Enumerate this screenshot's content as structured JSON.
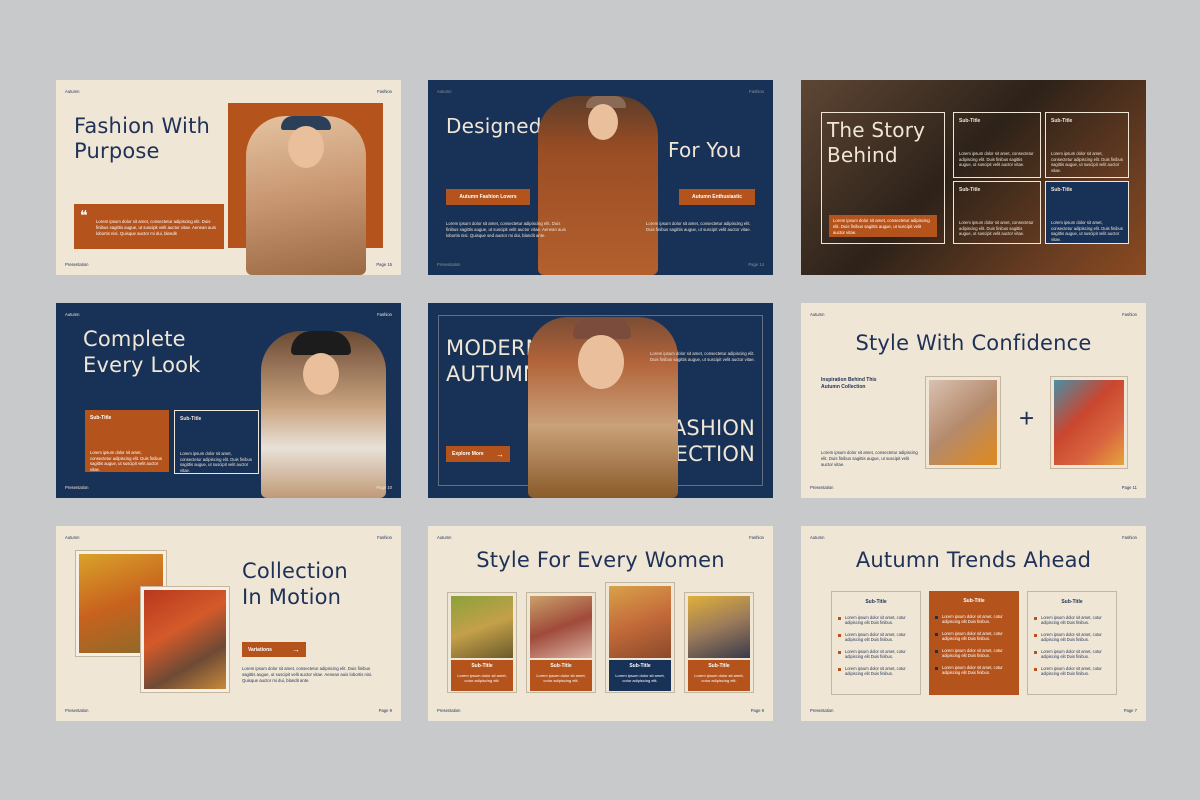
{
  "colors": {
    "background": "#c8c9ca",
    "cream": "#efe6d6",
    "navy": "#183157",
    "rust": "#b5531c"
  },
  "slide1": {
    "brand": "Autumn",
    "tag": "Fashion",
    "title_line1": "Fashion With",
    "title_line2": "Purpose",
    "quote": "Lorem ipsum dolor sit amet, consectetur adipiscing elit. Duis finibus sagittis augue, ut suscipit velit auctor vitae. Aenean auis lobortis nisi. Quisque auctor mi dui, blandit",
    "footer_left": "Presentation",
    "footer_right": "Page 15"
  },
  "slide2": {
    "brand": "Autumn",
    "tag": "Fashion",
    "title_line1": "Designed",
    "title_line2": "For You",
    "badge_left": "Autumn Fashion Lovers",
    "badge_right": "Autumn Enthusiastic",
    "text_left": "Lorem ipsum dolor sit amet, consectetur adipiscing elit. Duis finibus sagittis augue, ut suscipit velit auctor vitae. Aenean auis lobortis nisi. Quisque sed auctor mi dui, blandit ante.",
    "text_right": "Lorem ipsum dolor sit amet, consectetur adipiscing elit. Duis finibus sagittis augue, ut suscipit velit auctor vitae.",
    "footer_left": "Presentation",
    "footer_right": "Page 14"
  },
  "slide3": {
    "title_line1": "The Story",
    "title_line2": "Behind",
    "body": "Lorem ipsum dolor sit amet, consectetur adipiscing elit. Duis finibus sagittis augue, ut suscipit velit auctor vitae.",
    "box_label": "Sub-Title",
    "box_text": "Lorem ipsum dolor sit amet, consectetur adipiscing elit. Duis finibus sagittis augue, ut suscipit velit auctor vitae."
  },
  "slide4": {
    "brand": "Autumn",
    "tag": "Fashion",
    "title_line1": "Complete",
    "title_line2": "Every Look",
    "box1_label": "Sub-Title",
    "box2_label": "Sub-Title",
    "box_text": "Lorem ipsum dolor sit amet, consectetur adipiscing elit. Duis finibus sagittis augue, ut suscipit velit auctor vitae.",
    "footer_left": "Presentation",
    "footer_right": "Page 10"
  },
  "slide5": {
    "title_line1": "MODERN",
    "title_line2": "AUTUMN",
    "title_line3": "FASHION",
    "title_line4": "COLLECTION",
    "text": "Lorem ipsum dolor sit amet, consectetur adipiscing elit. Duis finibus sagittis augue, ut suscipit velit auctor vitae.",
    "button": "Explore More"
  },
  "slide6": {
    "brand": "Autumn",
    "tag": "Fashion",
    "title": "Style With Confidence",
    "subtitle_line1": "Inspiration Behind This",
    "subtitle_line2": "Autumn Collection",
    "text": "Lorem ipsum dolor sit amet, consectetur adipiscing elit. Duis finibus sagittis augue, ut suscipit velit auctor vitae.",
    "plus": "+",
    "footer_left": "Presentation",
    "footer_right": "Page 11"
  },
  "slide7": {
    "brand": "Autumn",
    "tag": "Fashion",
    "title_line1": "Collection",
    "title_line2": "In Motion",
    "button": "Variations",
    "text": "Lorem ipsum dolor sit amet, consectetur adipiscing elit. Duis finibus sagittis augue, ut suscipit velit auctor vitae. Aenean auis lobortis nisi. Quisque auctor mi dui, blandit ante.",
    "footer_left": "Presentation",
    "footer_right": "Page 9"
  },
  "slide8": {
    "brand": "Autumn",
    "tag": "Fashion",
    "title": "Style For Every Women",
    "card_label": "Sub-Title",
    "card_text": "Lorem ipsum dolor sit amet, cotur adipiscing elit.",
    "footer_left": "Presentation",
    "footer_right": "Page 8"
  },
  "slide9": {
    "brand": "Autumn",
    "tag": "Fashion",
    "title": "Autumn Trends Ahead",
    "col_label": "Sub-Title",
    "item_line1": "Lorem ipsum dolor sit amet, cotur",
    "item_line2": "adipiscing elit Duis finibus.",
    "footer_left": "Presentation",
    "footer_right": "Page 7"
  }
}
